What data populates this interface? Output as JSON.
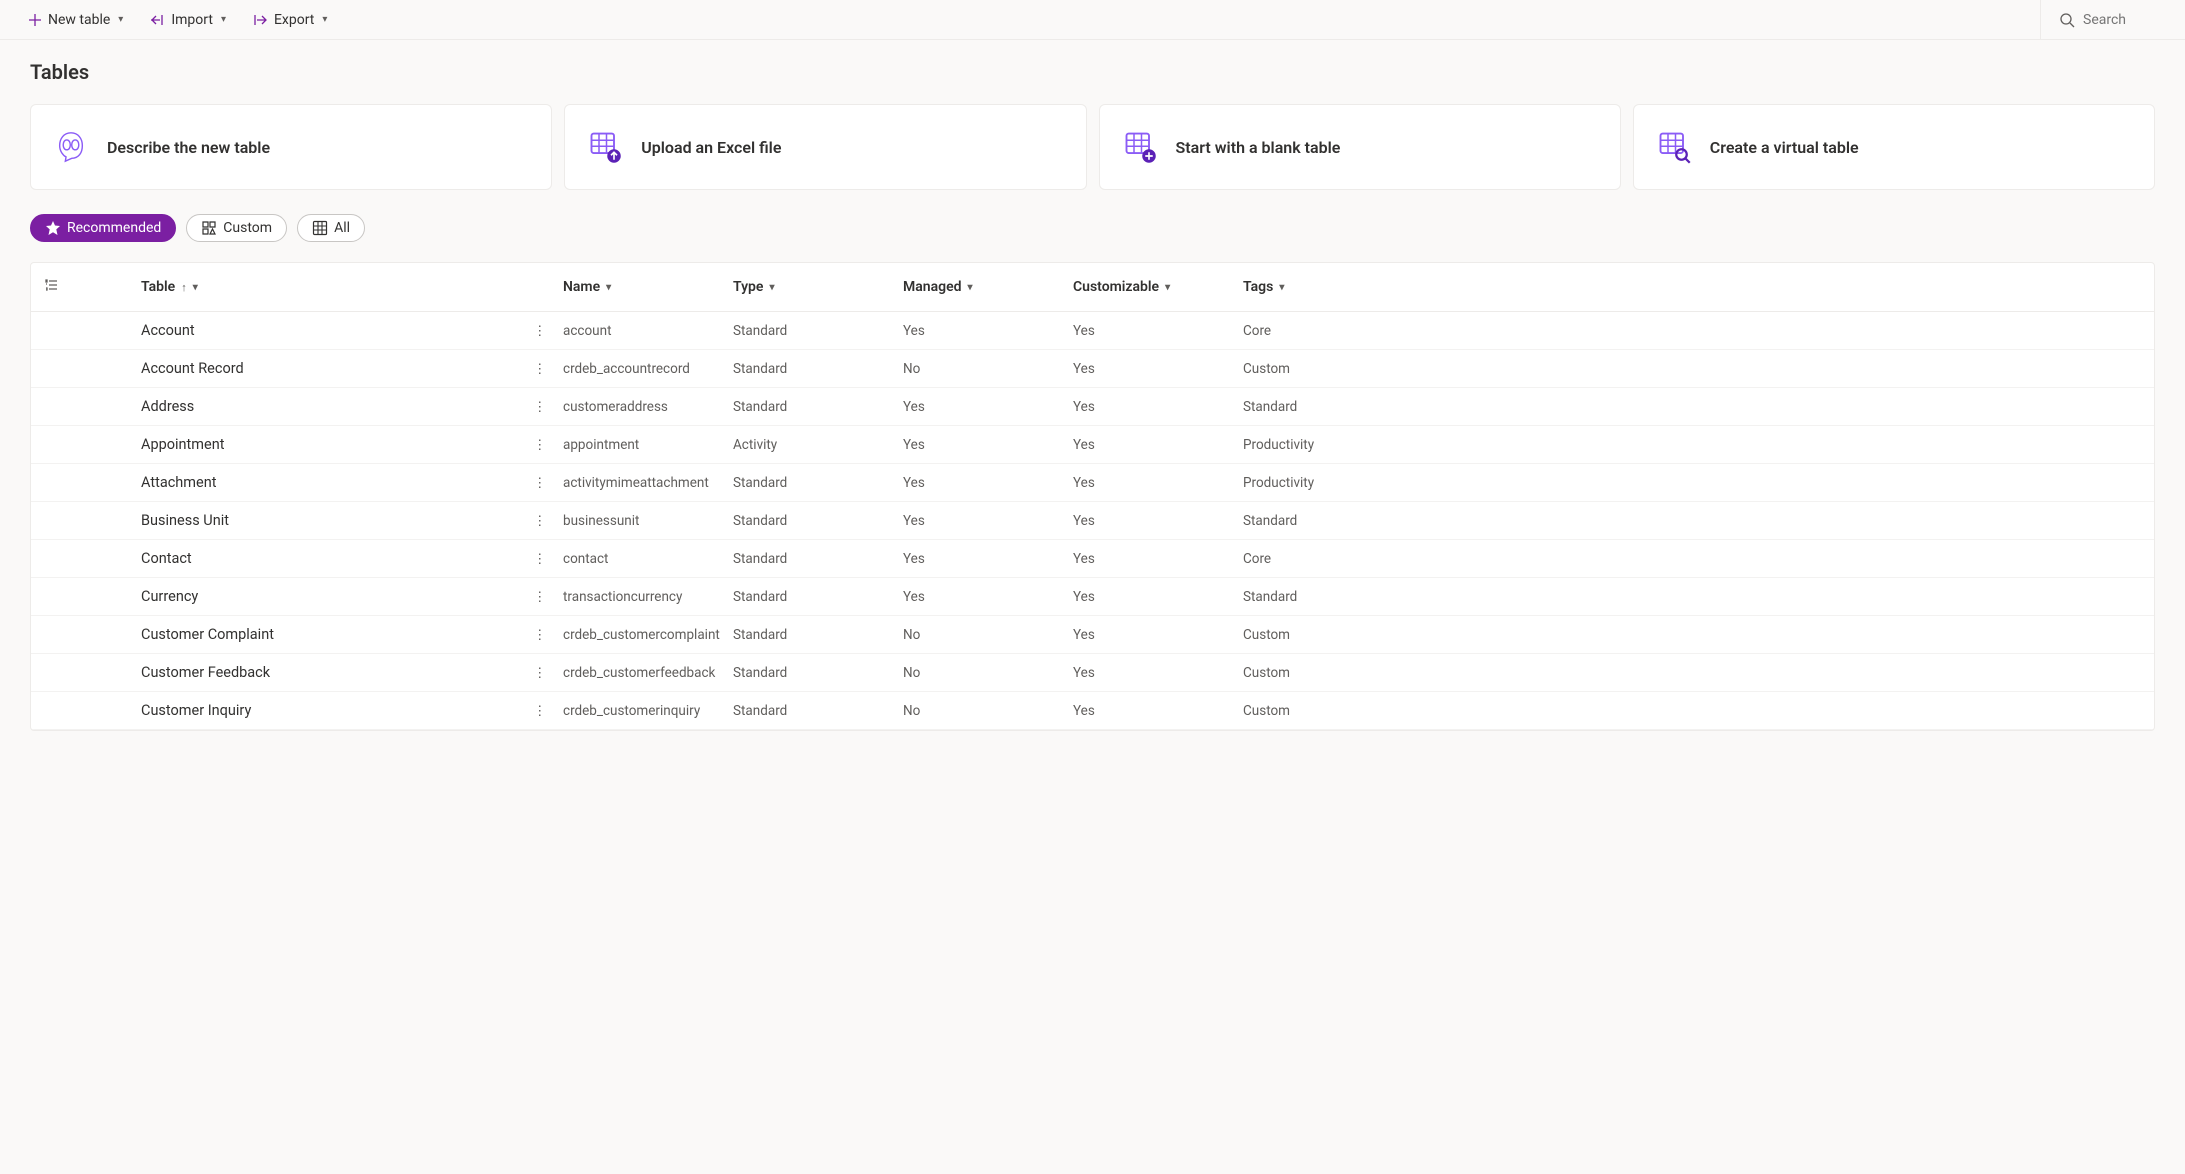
{
  "commandBar": {
    "newTable": "New table",
    "import": "Import",
    "export": "Export",
    "searchPlaceholder": "Search"
  },
  "pageTitle": "Tables",
  "cards": [
    {
      "title": "Describe the new table",
      "icon": "copilot"
    },
    {
      "title": "Upload an Excel file",
      "icon": "table-upload"
    },
    {
      "title": "Start with a blank table",
      "icon": "table-add"
    },
    {
      "title": "Create a virtual table",
      "icon": "table-search"
    }
  ],
  "filters": {
    "recommended": "Recommended",
    "custom": "Custom",
    "all": "All",
    "active": "recommended"
  },
  "columns": {
    "table": "Table",
    "name": "Name",
    "type": "Type",
    "managed": "Managed",
    "customizable": "Customizable",
    "tags": "Tags"
  },
  "rows": [
    {
      "table": "Account",
      "name": "account",
      "type": "Standard",
      "managed": "Yes",
      "customizable": "Yes",
      "tags": "Core"
    },
    {
      "table": "Account Record",
      "name": "crdeb_accountrecord",
      "type": "Standard",
      "managed": "No",
      "customizable": "Yes",
      "tags": "Custom"
    },
    {
      "table": "Address",
      "name": "customeraddress",
      "type": "Standard",
      "managed": "Yes",
      "customizable": "Yes",
      "tags": "Standard"
    },
    {
      "table": "Appointment",
      "name": "appointment",
      "type": "Activity",
      "managed": "Yes",
      "customizable": "Yes",
      "tags": "Productivity"
    },
    {
      "table": "Attachment",
      "name": "activitymimeattachment",
      "type": "Standard",
      "managed": "Yes",
      "customizable": "Yes",
      "tags": "Productivity"
    },
    {
      "table": "Business Unit",
      "name": "businessunit",
      "type": "Standard",
      "managed": "Yes",
      "customizable": "Yes",
      "tags": "Standard"
    },
    {
      "table": "Contact",
      "name": "contact",
      "type": "Standard",
      "managed": "Yes",
      "customizable": "Yes",
      "tags": "Core"
    },
    {
      "table": "Currency",
      "name": "transactioncurrency",
      "type": "Standard",
      "managed": "Yes",
      "customizable": "Yes",
      "tags": "Standard"
    },
    {
      "table": "Customer Complaint",
      "name": "crdeb_customercomplaint",
      "type": "Standard",
      "managed": "No",
      "customizable": "Yes",
      "tags": "Custom"
    },
    {
      "table": "Customer Feedback",
      "name": "crdeb_customerfeedback",
      "type": "Standard",
      "managed": "No",
      "customizable": "Yes",
      "tags": "Custom"
    },
    {
      "table": "Customer Inquiry",
      "name": "crdeb_customerinquiry",
      "type": "Standard",
      "managed": "No",
      "customizable": "Yes",
      "tags": "Custom"
    }
  ]
}
